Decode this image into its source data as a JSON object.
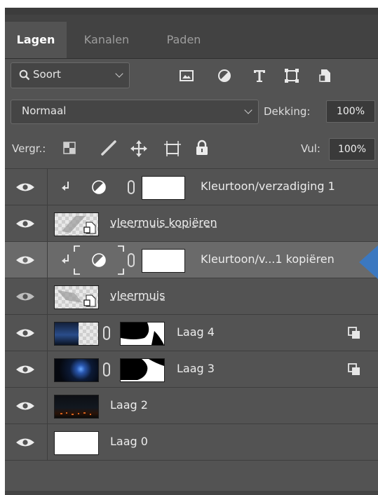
{
  "tabs": [
    {
      "label": "Lagen",
      "active": true
    },
    {
      "label": "Kanalen",
      "active": false
    },
    {
      "label": "Paden",
      "active": false
    }
  ],
  "filter": {
    "dropdown_label": "Soort",
    "icons": [
      "image-filter-icon",
      "adjustment-filter-icon",
      "type-filter-icon",
      "shape-filter-icon",
      "smart-object-filter-icon"
    ]
  },
  "blend": {
    "mode": "Normaal",
    "opacity_label": "Dekking:",
    "opacity_value": "100%"
  },
  "lock": {
    "label": "Vergr.:",
    "fill_label": "Vul:",
    "fill_value": "100%"
  },
  "layers": [
    {
      "name": "Kleurtoon/verzadiging 1",
      "type": "adjustment",
      "clipped": true,
      "selected": false
    },
    {
      "name": "vleermuis kopiëren",
      "type": "smart-object",
      "selected": false
    },
    {
      "name": "Kleurtoon/v...1 kopiëren",
      "type": "adjustment",
      "clipped": true,
      "selected": true
    },
    {
      "name": "vleermuis",
      "type": "smart-object",
      "selected": false
    },
    {
      "name": "Laag 4",
      "type": "masked",
      "linked": true,
      "selected": false
    },
    {
      "name": "Laag 3",
      "type": "masked",
      "linked": true,
      "selected": false
    },
    {
      "name": "Laag 2",
      "type": "pixel",
      "selected": false
    },
    {
      "name": "Laag 0",
      "type": "pixel",
      "selected": false
    }
  ],
  "colors": {
    "panel": "#535353",
    "selected_row": "#6a6a6a",
    "indicator_arrow": "#3b78c0"
  }
}
